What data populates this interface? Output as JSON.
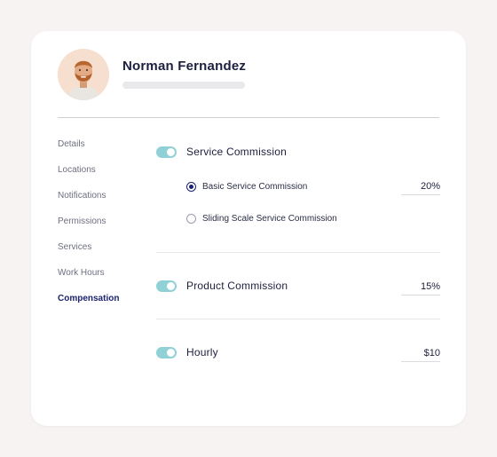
{
  "profile": {
    "name": "Norman Fernandez",
    "avatar_icon": "person-avatar"
  },
  "sidebar": {
    "items": [
      {
        "label": "Details"
      },
      {
        "label": "Locations"
      },
      {
        "label": "Notifications"
      },
      {
        "label": "Permissions"
      },
      {
        "label": "Services"
      },
      {
        "label": "Work Hours"
      },
      {
        "label": "Compensation",
        "active": true
      }
    ]
  },
  "compensation": {
    "service": {
      "label": "Service Commission",
      "enabled": true,
      "options": [
        {
          "label": "Basic Service Commission",
          "selected": true,
          "value": "20%"
        },
        {
          "label": "Sliding Scale Service Commission",
          "selected": false
        }
      ]
    },
    "product": {
      "label": "Product Commission",
      "enabled": true,
      "value": "15%"
    },
    "hourly": {
      "label": "Hourly",
      "enabled": true,
      "value": "$10"
    }
  },
  "colors": {
    "accent_toggle": "#8fd1d6",
    "active_nav": "#1b2270",
    "background": "#f6f3f2"
  }
}
